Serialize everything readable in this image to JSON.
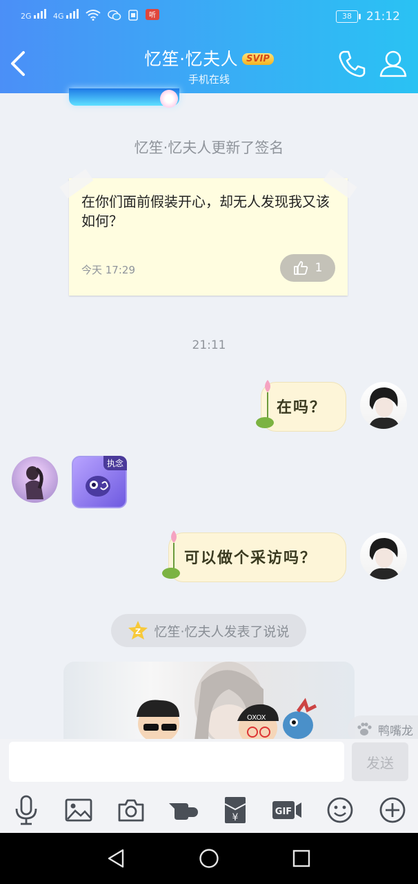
{
  "status_bar": {
    "network1": "2G",
    "network2": "4G",
    "battery": "38",
    "time": "21:12"
  },
  "header": {
    "title": "忆笙·忆夫人",
    "badge": "SVIP",
    "subtitle": "手机在线"
  },
  "messages": {
    "signature_notice": "忆笙·忆夫人更新了签名",
    "signature_text": "在你们面前假装开心，却无人发现我又该如何？",
    "signature_time": "今天 17:29",
    "signature_likes": "1",
    "timestamp": "21:11",
    "msg1": "在吗？",
    "sticker_tag": "执念",
    "msg2": "可以做个采访吗？",
    "qzone_notice": "忆笙·忆夫人发表了说说"
  },
  "side_tip": "鸭嘴龙",
  "input": {
    "placeholder": "",
    "send_label": "发送"
  },
  "toolbar": [
    "mic-icon",
    "image-icon",
    "camera-icon",
    "poke-icon",
    "red-packet-icon",
    "gif-icon",
    "emoji-icon",
    "plus-icon"
  ],
  "colors": {
    "header_start": "#4b8ff7",
    "header_end": "#2ac2f3",
    "svip_gold": "#f4b321",
    "bubble": "#fdf5d8",
    "note": "#fffde0"
  }
}
